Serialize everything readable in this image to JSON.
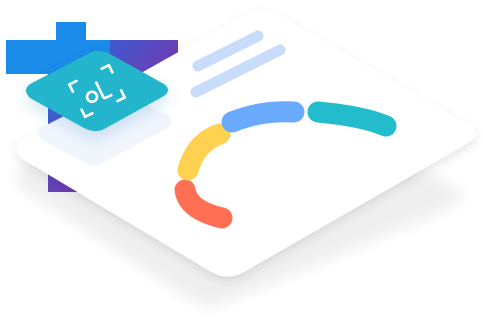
{
  "illustration": {
    "kind": "isometric-dashboard-illustration",
    "icons": [
      "scan-face-icon"
    ],
    "colors": {
      "card": "#ffffff",
      "shadow": "#eeeeef",
      "text_lines": "#c9dcfb",
      "icon_tile": "#22b5cc",
      "gradient_start": "#1a6fe6",
      "gradient_end": "#b0168c",
      "arc_red": "#ff6f54",
      "arc_yellow": "#ffd150",
      "arc_blue": "#6aaafc",
      "arc_teal": "#23bccc"
    }
  }
}
